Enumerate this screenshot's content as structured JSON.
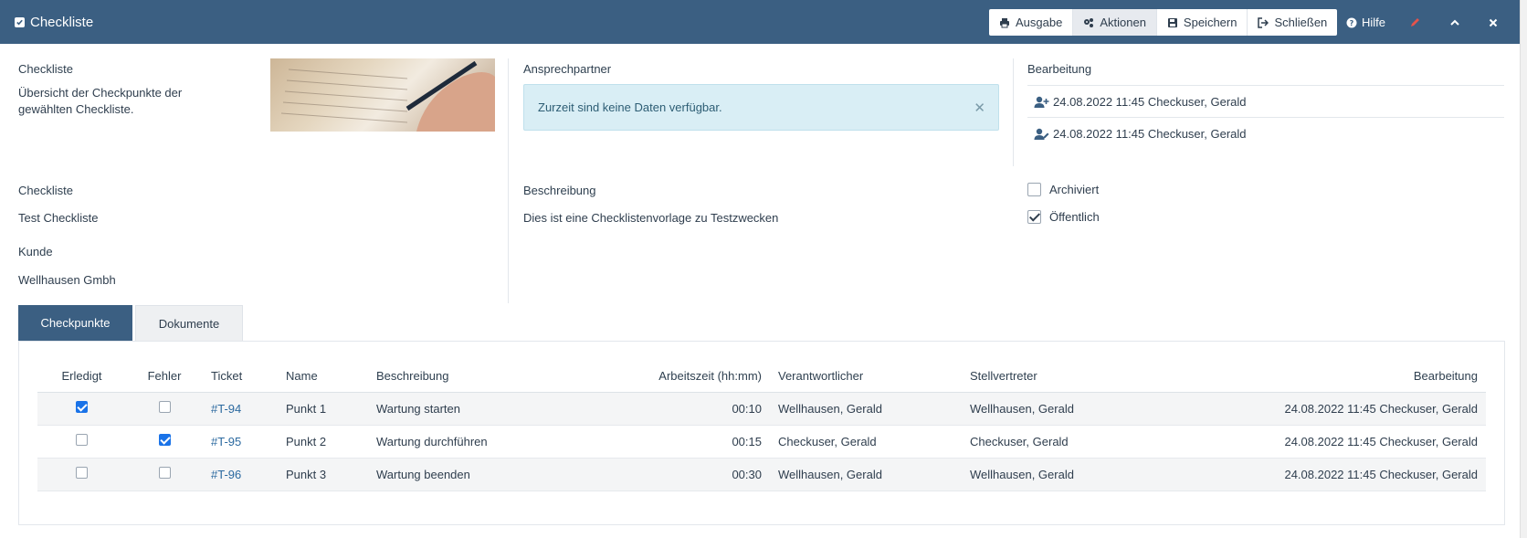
{
  "header": {
    "title": "Checkliste",
    "buttons": {
      "ausgabe": "Ausgabe",
      "aktionen": "Aktionen",
      "speichern": "Speichern",
      "schliessen": "Schließen"
    },
    "help": "Hilfe",
    "bg_color": "#3b5f82"
  },
  "intro": {
    "label": "Checkliste",
    "text": "Übersicht der Checkpunkte der gewählten Checkliste."
  },
  "ansprechpartner": {
    "label": "Ansprechpartner",
    "alert": "Zurzeit sind keine Daten verfügbar."
  },
  "bearbeitung": {
    "label": "Bearbeitung",
    "rows": [
      {
        "icon": "user-plus-icon",
        "text": "24.08.2022 11:45 Checkuser, Gerald"
      },
      {
        "icon": "user-edit-icon",
        "text": "24.08.2022 11:45 Checkuser, Gerald"
      }
    ]
  },
  "details": {
    "checkliste_label": "Checkliste",
    "checkliste_value": "Test Checkliste",
    "kunde_label": "Kunde",
    "kunde_value": "Wellhausen Gmbh",
    "beschreibung_label": "Beschreibung",
    "beschreibung_value": "Dies ist eine Checklistenvorlage zu Testzwecken",
    "archiviert_label": "Archiviert",
    "archiviert": false,
    "oeffentlich_label": "Öffentlich",
    "oeffentlich": true
  },
  "tabs": [
    {
      "label": "Checkpunkte",
      "active": true
    },
    {
      "label": "Dokumente",
      "active": false
    }
  ],
  "table": {
    "columns": [
      "Erledigt",
      "Fehler",
      "Ticket",
      "Name",
      "Beschreibung",
      "Arbeitszeit (hh:mm)",
      "Verantwortlicher",
      "Stellvertreter",
      "Bearbeitung"
    ],
    "rows": [
      {
        "erledigt": true,
        "fehler": false,
        "ticket": "#T-94",
        "name": "Punkt 1",
        "beschreibung": "Wartung starten",
        "arbeitszeit": "00:10",
        "verantwortlicher": "Wellhausen, Gerald",
        "stellvertreter": "Wellhausen, Gerald",
        "bearbeitung": "24.08.2022 11:45 Checkuser, Gerald"
      },
      {
        "erledigt": false,
        "fehler": true,
        "ticket": "#T-95",
        "name": "Punkt 2",
        "beschreibung": "Wartung durchführen",
        "arbeitszeit": "00:15",
        "verantwortlicher": "Checkuser, Gerald",
        "stellvertreter": "Checkuser, Gerald",
        "bearbeitung": "24.08.2022 11:45 Checkuser, Gerald"
      },
      {
        "erledigt": false,
        "fehler": false,
        "ticket": "#T-96",
        "name": "Punkt 3",
        "beschreibung": "Wartung beenden",
        "arbeitszeit": "00:30",
        "verantwortlicher": "Wellhausen, Gerald",
        "stellvertreter": "Wellhausen, Gerald",
        "bearbeitung": "24.08.2022 11:45 Checkuser, Gerald"
      }
    ]
  }
}
